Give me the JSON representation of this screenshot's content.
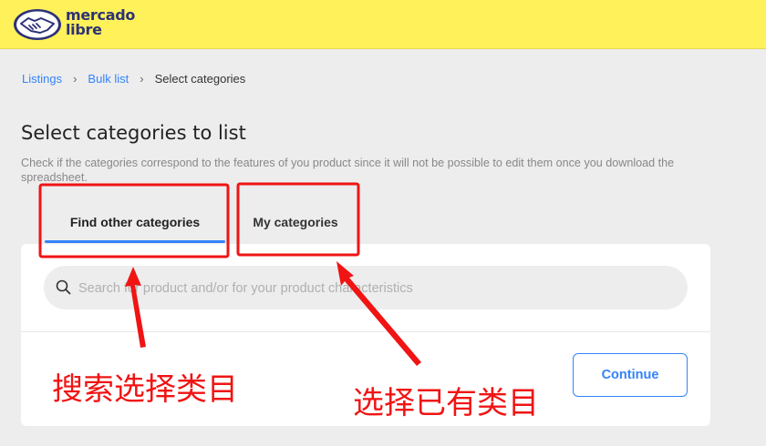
{
  "header": {
    "logo_line1": "mercado",
    "logo_line2": "libre",
    "brand_colors": {
      "bar": "#fff159",
      "logo": "#2d3277"
    }
  },
  "breadcrumb": {
    "items": [
      "Listings",
      "Bulk list"
    ],
    "current": "Select categories"
  },
  "page": {
    "title": "Select categories to list",
    "description": "Check if the categories correspond to the features of you product since it will not be possible to edit them once you download the spreadsheet."
  },
  "tabs": [
    {
      "label": "Find other categories",
      "selected": true
    },
    {
      "label": "My categories",
      "selected": false
    }
  ],
  "search": {
    "placeholder": "Search for product and/or for your product characteristics",
    "value": ""
  },
  "actions": {
    "continue_label": "Continue"
  },
  "annotations": {
    "search_note": "搜索选择类目",
    "existing_note": "选择已有类目",
    "color": "#f01414"
  },
  "accent_color": "#3483fa"
}
